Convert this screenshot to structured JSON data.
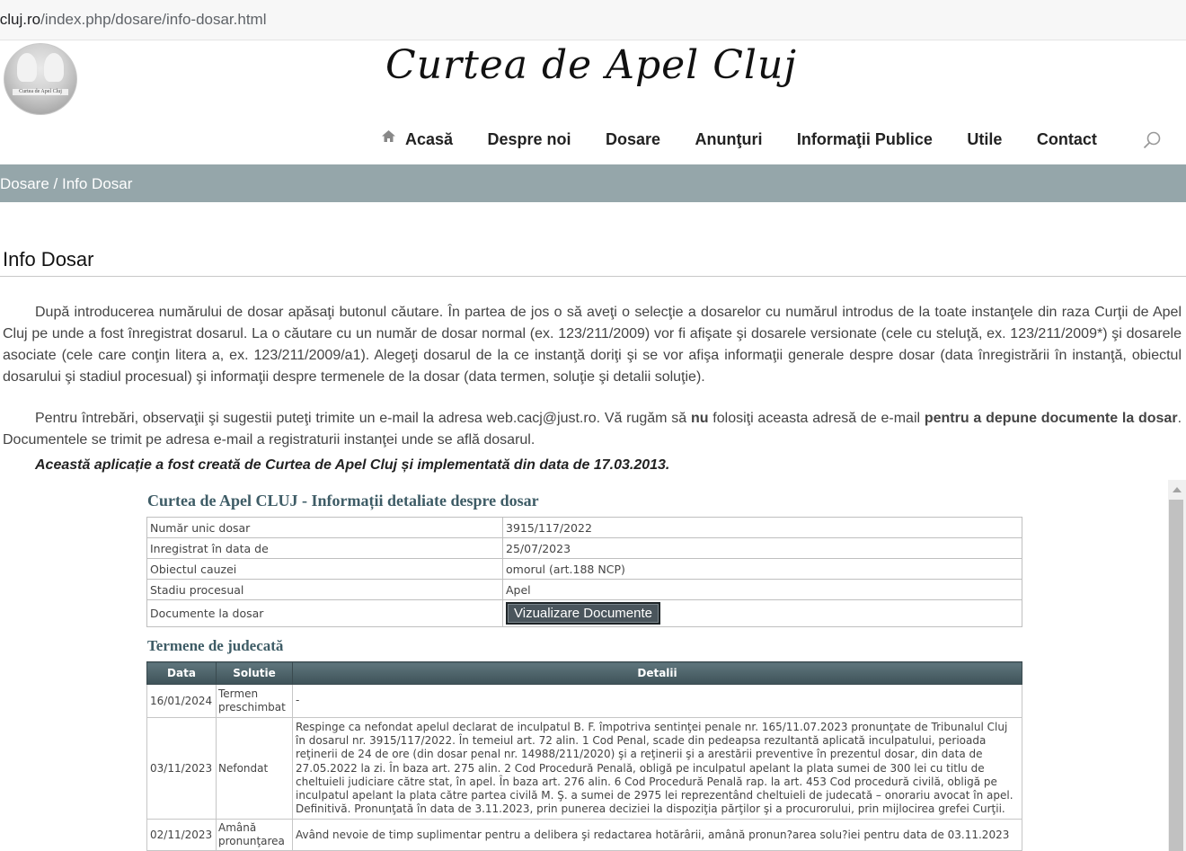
{
  "browser": {
    "url_host": "lcluj.ro",
    "url_path": "/index.php/dosare/info-dosar.html"
  },
  "site": {
    "title": "Curtea de Apel Cluj",
    "logo_caption": "Curtea de Apel Cluj"
  },
  "nav": {
    "items": [
      "Acasă",
      "Despre noi",
      "Dosare",
      "Anunţuri",
      "Informaţii Publice",
      "Utile",
      "Contact"
    ]
  },
  "breadcrumb": "Dosare / Info Dosar",
  "page_title": "Info Dosar",
  "intro": {
    "p1": "După introducerea numărului de dosar apăsaţi butonul căutare. În partea de jos o să aveţi o selecţie a dosarelor cu numărul introdus de la toate instanţele din raza Curţii de Apel Cluj pe unde a fost înregistrat dosarul. La o căutare cu un număr de dosar normal (ex. 123/211/2009) vor fi afişate şi dosarele versionate (cele cu steluţă, ex. 123/211/2009*) şi dosarele asociate (cele care conţin litera a, ex. 123/211/2009/a1). Alegeţi dosarul de la ce instanţă doriţi şi se vor afişa informaţii generale despre dosar (data înregistrării în instanţă, obiectul dosarului şi stadiul procesual) şi informaţii despre termenele de la dosar (data termen, soluţie şi detalii soluţie).",
    "p2_a": "Pentru întrebări, observaţii şi sugestii puteţi trimite un e-mail la adresa web.cacj@just.ro. Vă rugăm să ",
    "p2_b": "nu",
    "p2_c": " folosiţi aceasta adresă de e-mail ",
    "p2_d": "pentru a depune documente la dosar",
    "p2_e": ". Documentele se trimit pe adresa e-mail a registraturii instanţei unde se află dosarul.",
    "note": "Această aplicație a fost creată de Curtea de Apel Cluj și implementată din data de 17.03.2013."
  },
  "details": {
    "title": "Curtea de Apel CLUJ - Informații detaliate despre dosar",
    "rows": [
      {
        "key": "Număr unic dosar",
        "value": "3915/117/2022"
      },
      {
        "key": "Inregistrat în data de",
        "value": "25/07/2023"
      },
      {
        "key": "Obiectul cauzei",
        "value": "omorul (art.188 NCP)"
      },
      {
        "key": "Stadiu procesual",
        "value": "Apel"
      }
    ],
    "docs_key": "Documente la dosar",
    "docs_button": "Vizualizare Documente"
  },
  "terms": {
    "title": "Termene de judecată",
    "headers": [
      "Data",
      "Solutie",
      "Detalii"
    ],
    "rows": [
      {
        "date": "16/01/2024",
        "solution": "Termen preschimbat",
        "details": "-"
      },
      {
        "date": "03/11/2023",
        "solution": "Nefondat",
        "details": "Respinge ca nefondat apelul declarat de inculpatul B. F. împotriva sentinţei penale nr. 165/11.07.2023 pronunţate de Tribunalul Cluj în dosarul nr. 3915/117/2022. În temeiul art. 72 alin. 1 Cod Penal, scade din pedeapsa rezultantă aplicată inculpatului, perioada reţinerii de 24 de ore (din dosar penal nr. 14988/211/2020) şi a reţinerii şi a arestării preventive în prezentul dosar, din data de 27.05.2022 la zi. În baza art. 275 alin. 2 Cod Procedură Penală, obligă pe inculpatul apelant la plata sumei de 300 lei cu titlu de cheltuieli judiciare către stat, în apel. În baza art. 276 alin. 6 Cod Procedură Penală rap. la art. 453 Cod procedură civilă, obligă pe inculpatul apelant la plata către partea civilă M. Ş. a sumei de 2975 lei reprezentând cheltuieli de judecată – onorariu avocat în apel. Definitivă. Pronunţată în data de 3.11.2023, prin punerea deciziei la dispoziţia părţilor şi a procurorului, prin mijlocirea grefei Curţii."
      },
      {
        "date": "02/11/2023",
        "solution": "Amână pronunţarea",
        "details": "Având nevoie de timp suplimentar pentru a delibera şi redactarea hotărârii, amână pronun?area solu?iei pentru data de 03.11.2023"
      }
    ]
  }
}
